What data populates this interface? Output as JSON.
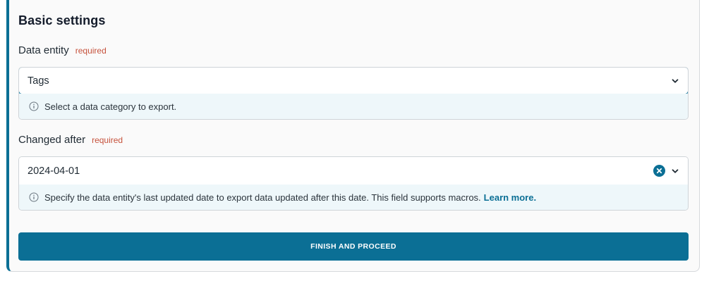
{
  "section": {
    "title": "Basic settings"
  },
  "data_entity": {
    "label": "Data entity",
    "required": "required",
    "value": "Tags",
    "help": "Select a data category to export."
  },
  "changed_after": {
    "label": "Changed after",
    "required": "required",
    "value": "2024-04-01",
    "help": "Specify the data entity's last updated date to export data updated after this date. This field supports macros.",
    "help_link": "Learn more."
  },
  "actions": {
    "submit_label": "FINISH AND PROCEED"
  },
  "colors": {
    "accent": "#0b6f95",
    "required": "#c6523c",
    "help_bg": "#eef7fa"
  },
  "icons": [
    "info-icon",
    "chevron-down-icon",
    "clear-icon"
  ]
}
